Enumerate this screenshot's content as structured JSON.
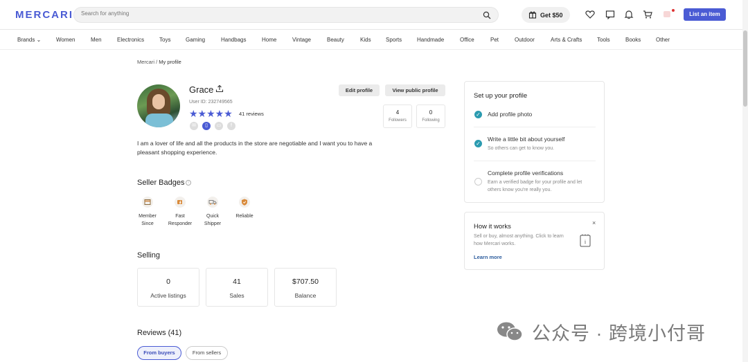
{
  "header": {
    "logo": "MERCARI",
    "search_placeholder": "Search for anything",
    "get50_label": "Get $50",
    "list_button": "List an item"
  },
  "categories": [
    "Brands ⌄",
    "Women",
    "Men",
    "Electronics",
    "Toys",
    "Gaming",
    "Handbags",
    "Home",
    "Vintage",
    "Beauty",
    "Kids",
    "Sports",
    "Handmade",
    "Office",
    "Pet",
    "Outdoor",
    "Arts & Crafts",
    "Tools",
    "Books",
    "Other"
  ],
  "breadcrumb": {
    "root": "Mercari",
    "sep": "/",
    "current": "My profile"
  },
  "profile": {
    "name": "Grace",
    "user_id": "User ID: 232749565",
    "stars": "★★★★★",
    "reviews": "41 reviews",
    "edit_button": "Edit profile",
    "view_button": "View public profile",
    "followers_count": "4",
    "followers_label": "Followers",
    "following_count": "0",
    "following_label": "Following",
    "bio": "I am a lover of life and all the products in the store are negotiable and I want you to have a pleasant shopping experience."
  },
  "badges": {
    "title": "Seller Badges",
    "items": [
      {
        "line1": "Member",
        "line2": "Since"
      },
      {
        "line1": "Fast",
        "line2": "Responder"
      },
      {
        "line1": "Quick",
        "line2": "Shipper"
      },
      {
        "line1": "Reliable",
        "line2": ""
      }
    ]
  },
  "selling": {
    "title": "Selling",
    "cards": [
      {
        "value": "0",
        "label": "Active listings"
      },
      {
        "value": "41",
        "label": "Sales"
      },
      {
        "value": "$707.50",
        "label": "Balance"
      }
    ]
  },
  "reviews_section": {
    "title": "Reviews (41)",
    "tab_buyers": "From buyers",
    "tab_sellers": "From sellers"
  },
  "setup": {
    "title": "Set up your profile",
    "steps": [
      {
        "title": "Add profile photo",
        "sub": "",
        "done": true
      },
      {
        "title": "Write a little bit about yourself",
        "sub": "So others can get to know you.",
        "done": true
      },
      {
        "title": "Complete profile verifications",
        "sub": "Earn a verified badge for your profile and let others know you're really you.",
        "done": false
      }
    ]
  },
  "how_it_works": {
    "title": "How it works",
    "text": "Sell or buy, almost anything. Click to learn how Mercari works.",
    "link": "Learn more",
    "close": "×"
  },
  "watermark": "公众号 · 跨境小付哥",
  "colors": {
    "brand": "#4a5bd4",
    "check": "#2b9bb0"
  }
}
